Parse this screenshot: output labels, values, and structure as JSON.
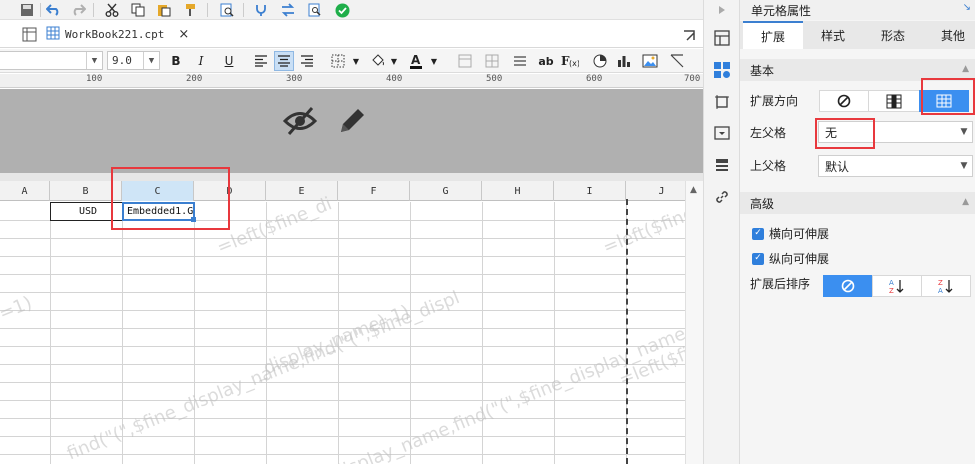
{
  "tab": {
    "filename": "WorkBook221.cpt"
  },
  "format_bar": {
    "font_size": "9.0"
  },
  "ruler": {
    "labels": [
      "100",
      "200",
      "300",
      "400",
      "500",
      "600",
      "700"
    ]
  },
  "sheet": {
    "columns": [
      "A",
      "B",
      "C",
      "D",
      "E",
      "F",
      "G",
      "H",
      "I",
      "J"
    ],
    "selected_column": "C",
    "cells": {
      "B1": "USD",
      "C1": "Embedded1.G"
    },
    "watermark_lines": [
      "=left($fine_di",
      "=left($fine_d",
      "=1)",
      "_display_name)-1)",
      "find(\"(\",$fine_display_name,find(\"(\",$fine_displ",
      "display_name,find(\"(\",$fine_display_name,find(\"(\",$fine_disp",
      "=left($fine_dis"
    ]
  },
  "properties": {
    "title": "单元格属性",
    "tabs": [
      "扩展",
      "样式",
      "形态",
      "其他"
    ],
    "active_tab": "扩展",
    "basic": {
      "section_label": "基本",
      "expand_direction_label": "扩展方向",
      "left_parent_label": "左父格",
      "left_parent_value": "无",
      "upper_parent_label": "上父格",
      "upper_parent_value": "默认"
    },
    "advanced": {
      "section_label": "高级",
      "horizontal_expandable": "横向可伸展",
      "vertical_expandable": "纵向可伸展",
      "sort_after_expand_label": "扩展后排序"
    }
  },
  "colors": {
    "accent": "#3b8ff0",
    "highlight_box": "#e8383d",
    "hidden_area": "#b0b0b0"
  }
}
